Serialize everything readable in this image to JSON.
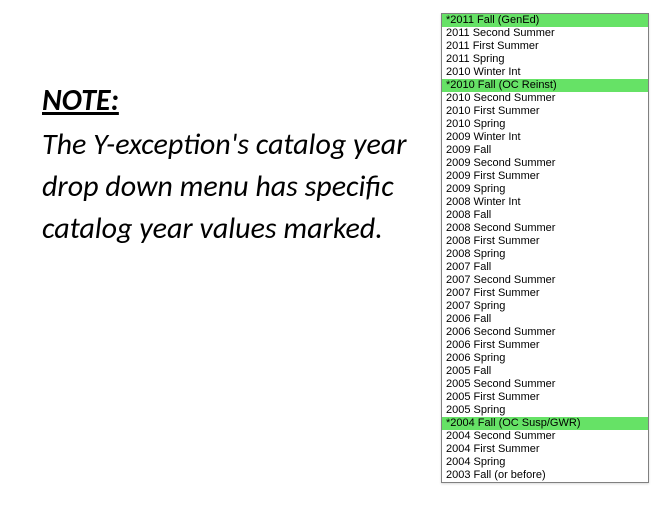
{
  "note": {
    "heading": "NOTE:",
    "body": "The Y-exception's catalog year drop down menu has specific catalog year values marked."
  },
  "dropdown": {
    "items": [
      {
        "label": "*2011 Fall (GenEd)",
        "marked": true
      },
      {
        "label": "2011 Second Summer",
        "marked": false
      },
      {
        "label": "2011 First Summer",
        "marked": false
      },
      {
        "label": "2011 Spring",
        "marked": false
      },
      {
        "label": "2010 Winter Int",
        "marked": false
      },
      {
        "label": "*2010 Fall (OC Reinst)",
        "marked": true
      },
      {
        "label": "2010 Second Summer",
        "marked": false
      },
      {
        "label": "2010 First Summer",
        "marked": false
      },
      {
        "label": "2010 Spring",
        "marked": false
      },
      {
        "label": "2009 Winter Int",
        "marked": false
      },
      {
        "label": "2009 Fall",
        "marked": false
      },
      {
        "label": "2009 Second Summer",
        "marked": false
      },
      {
        "label": "2009 First Summer",
        "marked": false
      },
      {
        "label": "2009 Spring",
        "marked": false
      },
      {
        "label": "2008 Winter Int",
        "marked": false
      },
      {
        "label": "2008 Fall",
        "marked": false
      },
      {
        "label": "2008 Second Summer",
        "marked": false
      },
      {
        "label": "2008 First Summer",
        "marked": false
      },
      {
        "label": "2008 Spring",
        "marked": false
      },
      {
        "label": "2007 Fall",
        "marked": false
      },
      {
        "label": "2007 Second Summer",
        "marked": false
      },
      {
        "label": "2007 First Summer",
        "marked": false
      },
      {
        "label": "2007 Spring",
        "marked": false
      },
      {
        "label": "2006 Fall",
        "marked": false
      },
      {
        "label": "2006 Second Summer",
        "marked": false
      },
      {
        "label": "2006 First Summer",
        "marked": false
      },
      {
        "label": "2006 Spring",
        "marked": false
      },
      {
        "label": "2005 Fall",
        "marked": false
      },
      {
        "label": "2005 Second Summer",
        "marked": false
      },
      {
        "label": "2005 First Summer",
        "marked": false
      },
      {
        "label": "2005 Spring",
        "marked": false
      },
      {
        "label": "*2004 Fall (OC Susp/GWR)",
        "marked": true
      },
      {
        "label": "2004 Second Summer",
        "marked": false
      },
      {
        "label": "2004 First Summer",
        "marked": false
      },
      {
        "label": "2004 Spring",
        "marked": false
      },
      {
        "label": "2003 Fall (or before)",
        "marked": false
      }
    ]
  }
}
